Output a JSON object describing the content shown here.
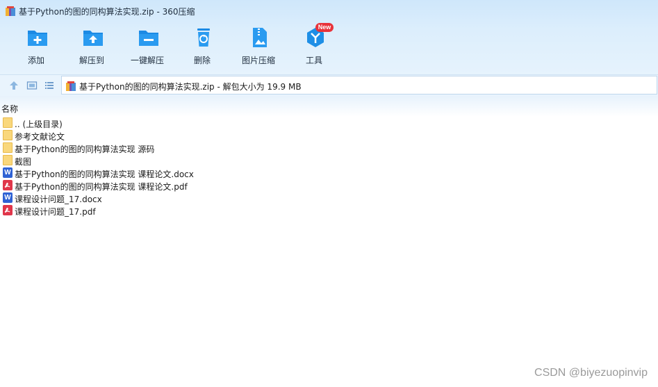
{
  "window": {
    "title": "基于Python的图的同构算法实现.zip - 360压缩"
  },
  "toolbar": {
    "items": [
      {
        "label": "添加",
        "icon": "add-folder-icon"
      },
      {
        "label": "解压到",
        "icon": "extract-to-icon"
      },
      {
        "label": "一键解压",
        "icon": "one-click-extract-icon"
      },
      {
        "label": "删除",
        "icon": "recycle-bin-icon"
      },
      {
        "label": "图片压缩",
        "icon": "image-compress-icon"
      },
      {
        "label": "工具",
        "icon": "tools-icon"
      }
    ],
    "new_badge": "New"
  },
  "address": {
    "text": "基于Python的图的同构算法实现.zip - 解包大小为 19.9 MB"
  },
  "list": {
    "column_name": "名称",
    "files": [
      {
        "name": ".. (上级目录)",
        "type": "folder"
      },
      {
        "name": "参考文献论文",
        "type": "folder"
      },
      {
        "name": "基于Python的图的同构算法实现 源码",
        "type": "folder"
      },
      {
        "name": "截图",
        "type": "folder"
      },
      {
        "name": "基于Python的图的同构算法实现 课程论文.docx",
        "type": "word"
      },
      {
        "name": "基于Python的图的同构算法实现 课程论文.pdf",
        "type": "pdf"
      },
      {
        "name": "课程设计问题_17.docx",
        "type": "word"
      },
      {
        "name": "课程设计问题_17.pdf",
        "type": "pdf"
      }
    ]
  },
  "watermark": "CSDN @biyezuopinvip",
  "colors": {
    "accent": "#1e8fe6",
    "toolbar_bg": "#d6ebfc",
    "badge": "#e8333b"
  }
}
